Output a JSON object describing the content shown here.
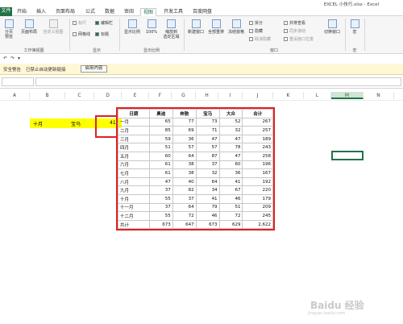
{
  "window": {
    "title": "EXCEL 小技巧.xlsx - Excel"
  },
  "tabs": [
    "文件",
    "开始",
    "插入",
    "页面布局",
    "公式",
    "数据",
    "审阅",
    "视图",
    "开发工具",
    "百度网盘"
  ],
  "active_tab": "视图",
  "ribbon": {
    "page_break": "分页\n预览",
    "page_layout": "页面布局",
    "custom_view": "自定义视图",
    "g1_label": "工作簿视图",
    "ruler": "标尺",
    "formula_bar": "编辑栏",
    "gridlines": "网格线",
    "headings": "标题",
    "g2_label": "显示",
    "zoom": "显示比例",
    "zoom100": "100%",
    "zoom_sel": "缩放到\n选定区域",
    "g3_label": "显示比例",
    "new_window": "新建窗口",
    "arrange_all": "全部重排",
    "freeze": "冻结窗格",
    "split": "拆分",
    "hide": "隐藏",
    "unhide": "取消隐藏",
    "side_by_side": "并排查看",
    "sync_scroll": "同步滚动",
    "reset_pos": "重设窗口位置",
    "switch_win": "切换窗口",
    "g4_label": "窗口",
    "macro": "宏",
    "g5_label": "宏"
  },
  "security": {
    "label": "安全警告",
    "message": "已禁止自动更新链接",
    "button": "启用内容"
  },
  "columns": [
    "A",
    "B",
    "C",
    "D",
    "E",
    "F",
    "G",
    "H",
    "I",
    "J",
    "K",
    "L",
    "M",
    "N"
  ],
  "selected_column": "M",
  "lookup": {
    "month": "十月",
    "brand": "宝马",
    "value": "41"
  },
  "table": {
    "headers": [
      "日期",
      "奥迪",
      "奔驰",
      "宝马",
      "大众",
      "合计"
    ],
    "rows": [
      [
        "一月",
        "65",
        "77",
        "73",
        "52",
        "267"
      ],
      [
        "二月",
        "85",
        "69",
        "71",
        "32",
        "257"
      ],
      [
        "三月",
        "59",
        "36",
        "47",
        "47",
        "189"
      ],
      [
        "四月",
        "51",
        "57",
        "57",
        "78",
        "243"
      ],
      [
        "五月",
        "60",
        "64",
        "87",
        "47",
        "258"
      ],
      [
        "六月",
        "61",
        "38",
        "37",
        "60",
        "196"
      ],
      [
        "七月",
        "61",
        "38",
        "32",
        "36",
        "167"
      ],
      [
        "八月",
        "47",
        "40",
        "64",
        "41",
        "192"
      ],
      [
        "九月",
        "37",
        "82",
        "34",
        "67",
        "220"
      ],
      [
        "十月",
        "55",
        "37",
        "41",
        "46",
        "179"
      ],
      [
        "十一月",
        "37",
        "64",
        "79",
        "51",
        "209"
      ],
      [
        "十二月",
        "55",
        "72",
        "46",
        "72",
        "245"
      ],
      [
        "共计",
        "673",
        "647",
        "673",
        "629",
        "2,622"
      ]
    ]
  },
  "watermark": {
    "line1": "Baidu 经验",
    "line2": "jingyan.baidu.com"
  }
}
